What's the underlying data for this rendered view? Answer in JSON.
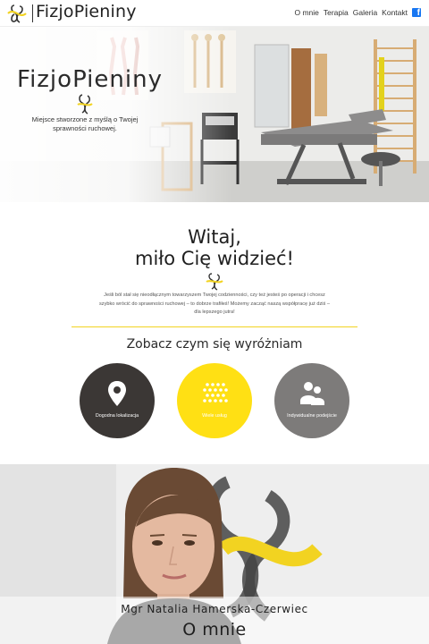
{
  "nav": {
    "logo_text": "FizjoPieniny",
    "menu": [
      "O mnie",
      "Terapia",
      "Galeria",
      "Kontakt"
    ],
    "facebook_icon": "facebook-icon"
  },
  "hero": {
    "brand": "FizjoPieniny",
    "tagline": "Miejsce stworzone z myślą o Twojej sprawności ruchowej."
  },
  "welcome": {
    "title_line1": "Witaj,",
    "title_line2": "miło Cię widzieć!",
    "text": "Jeśli ból stał się nieodłącznym towarzyszem Twojej codzienności, czy też jesteś po operacji i chcesz szybko wrócić do sprawności ruchowej – to dobrze trafiłeś! Możemy zacząć naszą współpracę już dziś – dla lepszego jutra!"
  },
  "features": {
    "title": "Zobacz czym się wyróżniam",
    "items": [
      {
        "label": "Dogodna lokalizacja",
        "icon": "location-pin-icon",
        "color": "#3b3735"
      },
      {
        "label": "Wiele usług",
        "icon": "dots-grid-icon",
        "color": "#ffe014"
      },
      {
        "label": "Indywidualne podejście",
        "icon": "people-icon",
        "color": "#7d7b7a"
      }
    ]
  },
  "about": {
    "name": "Mgr Natalia Hamerska-Czerwiec",
    "title": "O mnie"
  },
  "colors": {
    "accent": "#f2d321",
    "dark": "#3b3735",
    "gray": "#7d7b7a"
  }
}
